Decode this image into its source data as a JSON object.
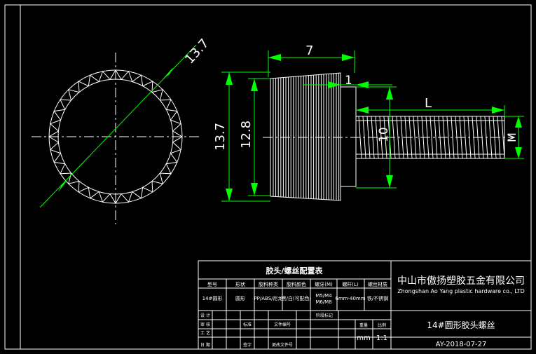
{
  "dimensions": {
    "circle_diameter": "13.7",
    "head_length": "7",
    "head_height": "13.7",
    "head_inner_height": "12.8",
    "shoulder_length": "1",
    "thread_length": "L",
    "shoulder_diameter": "10",
    "thread_diameter": "M"
  },
  "table": {
    "title": "胶头/螺丝配置表",
    "headers": [
      "型号",
      "形状",
      "胶料种类",
      "胶料颜色",
      "螺牙(M)",
      "螺杆(L)",
      "螺丝材质"
    ],
    "row": [
      "14#圆形",
      "圆形",
      "PP/ABS/尼龙",
      "黑/白(可配色)",
      "M5/M4 M6/M8",
      "6mm-40mm",
      "铁/不锈钢"
    ],
    "sig_rows": [
      [
        "设 计",
        "",
        "",
        "",
        "",
        "",
        "阶段标记",
        "",
        ""
      ],
      [
        "审 核",
        "",
        "",
        "标准",
        "",
        "文件编号",
        "",
        "",
        ""
      ],
      [
        "工 艺",
        "",
        "",
        "",
        "",
        "",
        "",
        "",
        ""
      ],
      [
        "日 期",
        "",
        "",
        "签字",
        "",
        "更改文件号",
        "",
        "",
        ""
      ]
    ],
    "weight_label": "重量",
    "ratio_label": "比例",
    "unit": "mm",
    "scale": "1:1"
  },
  "title_block": {
    "company_cn": "中山市傲扬塑胶五金有限公司",
    "company_en": "Zhongshan Ao Yang plastic hardware co., LTD",
    "part_name": "14#圆形胶头螺丝",
    "drawing_no": "AY-2018-07-27"
  }
}
